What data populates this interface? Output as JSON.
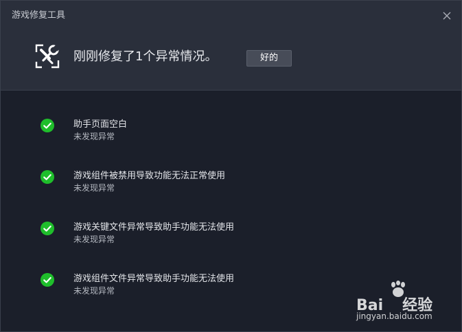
{
  "window": {
    "title": "游戏修复工具",
    "close_icon": "close-icon"
  },
  "summary": {
    "icon": "repair-tool-icon",
    "message": "刚刚修复了1个异常情况。",
    "ok_label": "好的"
  },
  "checks": [
    {
      "title": "助手页面空白",
      "status": "未发现异常",
      "icon": "check-circle-icon"
    },
    {
      "title": "游戏组件被禁用导致功能无法正常使用",
      "status": "未发现异常",
      "icon": "check-circle-icon"
    },
    {
      "title": "游戏关键文件异常导致助手功能无法使用",
      "status": "未发现异常",
      "icon": "check-circle-icon"
    },
    {
      "title": "游戏组件文件异常导致助手功能无法使用",
      "status": "未发现异常",
      "icon": "check-circle-icon"
    }
  ],
  "watermark": {
    "brand_text": "Bai",
    "brand_suffix": "经验",
    "url": "jingyan.baidu.com"
  },
  "colors": {
    "check_green": "#1fbe2b",
    "header_bg": "#2a2f3b",
    "body_bg": "#1b1f2a"
  }
}
